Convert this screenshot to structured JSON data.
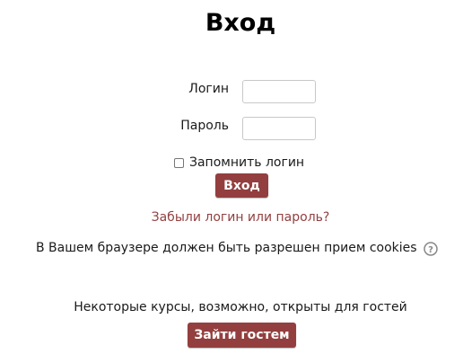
{
  "page": {
    "title": "Вход"
  },
  "login_form": {
    "username_label": "Логин",
    "username_value": "",
    "password_label": "Пароль",
    "password_value": "",
    "remember_label": "Запомнить логин",
    "remember_checked": false,
    "submit_label": "Вход",
    "forgot_link": "Забыли логин или пароль?"
  },
  "notices": {
    "cookies_text": "В Вашем браузере должен быть разрешен прием cookies",
    "help_icon": "question-circle-icon"
  },
  "guest": {
    "note": "Некоторые курсы, возможно, открыты для гостей",
    "button_label": "Зайти гостем"
  },
  "colors": {
    "accent": "#933f3f",
    "text": "#1a1a1a",
    "input_border": "#c8c8c8"
  }
}
